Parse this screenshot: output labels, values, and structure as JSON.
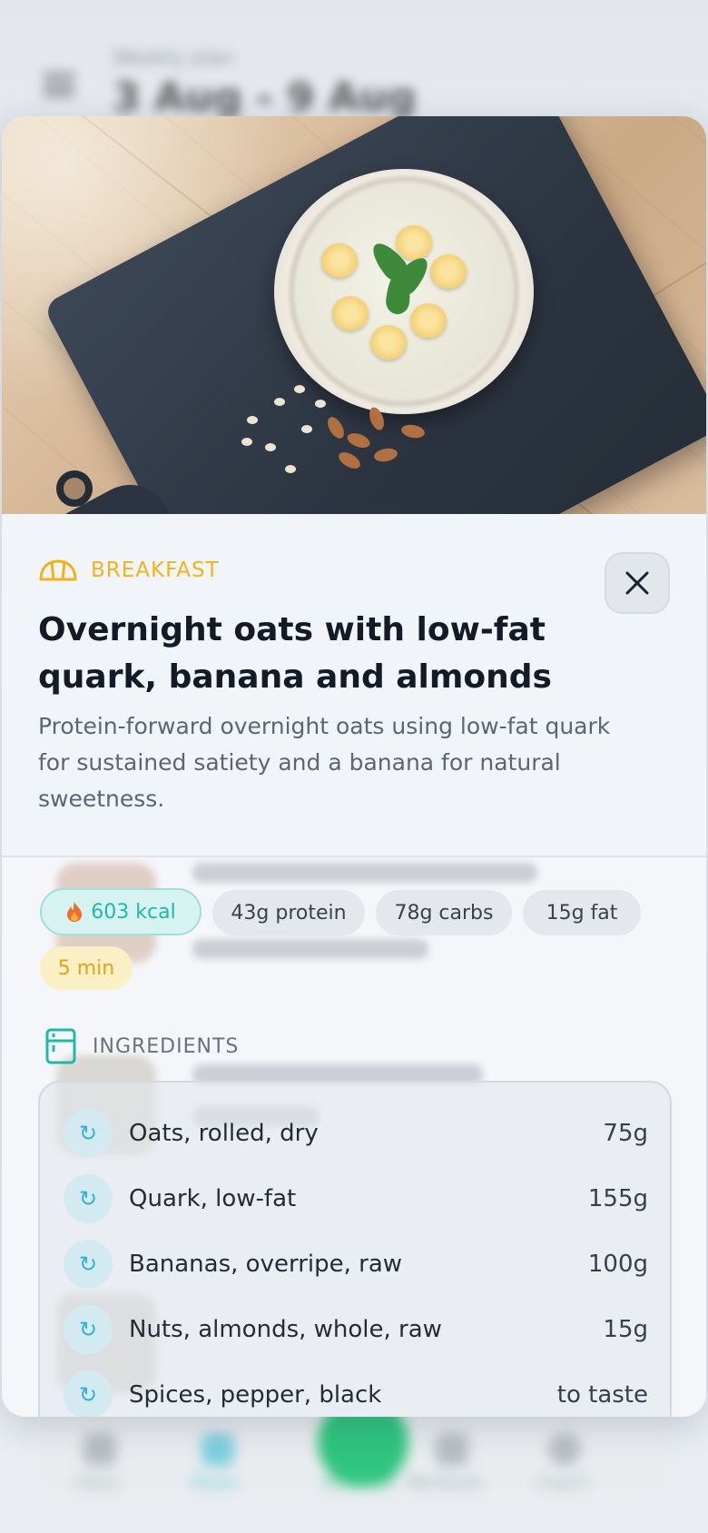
{
  "background": {
    "header_subtitle": "Weekly plan",
    "header_title": "3 Aug - 9 Aug",
    "tabs": [
      "Diary",
      "Meals",
      "Add food",
      "Workouts",
      "Coach"
    ]
  },
  "recipe": {
    "category": "BREAKFAST",
    "title": "Overnight oats with low-fat quark, banana and almonds",
    "description": "Protein-forward overnight oats using low-fat quark for sustained satiety and a banana for natural sweetness.",
    "close_icon": "close-icon",
    "nutrition": {
      "kcal": "603 kcal",
      "protein": "43g protein",
      "carbs": "78g carbs",
      "fat": "15g fat",
      "time": "5 min"
    },
    "ingredients_label": "INGREDIENTS",
    "ingredients": [
      {
        "name": "Oats, rolled, dry",
        "qty": "75g"
      },
      {
        "name": "Quark, low-fat",
        "qty": "155g"
      },
      {
        "name": "Bananas, overripe, raw",
        "qty": "100g"
      },
      {
        "name": "Nuts, almonds, whole, raw",
        "qty": "15g"
      },
      {
        "name": "Spices, pepper, black",
        "qty": "to taste"
      }
    ]
  },
  "colors": {
    "accent_breakfast": "#f1b418",
    "accent_kcal": "#1fb8ad",
    "accent_swap": "#2fb0d8"
  }
}
